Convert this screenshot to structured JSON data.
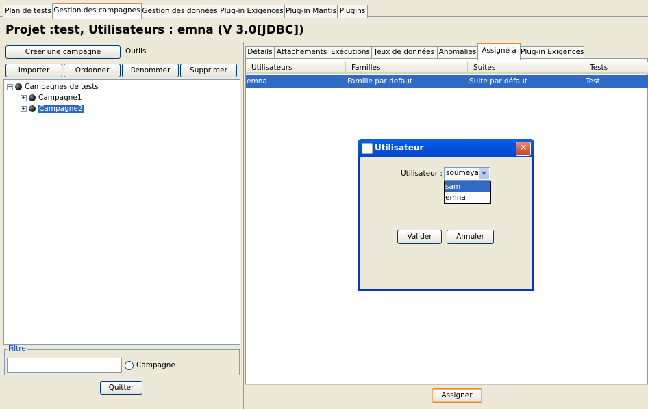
{
  "top_tabs": [
    {
      "label": "Plan de tests"
    },
    {
      "label": "Gestion des campagnes",
      "active": true
    },
    {
      "label": "Gestion des données"
    },
    {
      "label": "Plug-in Exigences"
    },
    {
      "label": "Plug-in Mantis"
    },
    {
      "label": "Plugins"
    }
  ],
  "header": {
    "title": "Projet :test, Utilisateurs : emna (V 3.0[JDBC])"
  },
  "left": {
    "create_campaign_label": "Créer une campagne",
    "tools_label": "Outils",
    "buttons": {
      "import": "Importer",
      "order": "Ordonner",
      "rename": "Renommer",
      "delete": "Supprimer"
    },
    "tree": {
      "root": "Campagnes de tests",
      "items": [
        {
          "label": "Campagne1"
        },
        {
          "label": "Campagne2",
          "selected": true
        }
      ]
    },
    "filter": {
      "legend": "Filtre",
      "value": "",
      "radio_label": "Campagne"
    },
    "quit_label": "Quitter"
  },
  "right": {
    "tabs": [
      {
        "label": "Détails"
      },
      {
        "label": "Attachements"
      },
      {
        "label": "Exécutions"
      },
      {
        "label": "Jeux de données"
      },
      {
        "label": "Anomalies"
      },
      {
        "label": "Assigné à",
        "active": true
      },
      {
        "label": "Plug-in Exigences"
      }
    ],
    "table": {
      "columns": [
        "Utilisateurs",
        "Familles",
        "Suites",
        "Tests"
      ],
      "rows": [
        [
          "emna",
          "Famille par defaut",
          "Suite par défaut",
          "Test"
        ]
      ]
    },
    "assign_label": "Assigner"
  },
  "dialog": {
    "title": "Utilisateur",
    "field_label": "Utilisateur :",
    "selected_value": "soumeya",
    "options": [
      {
        "label": "sam",
        "highlighted": true
      },
      {
        "label": "emna"
      }
    ],
    "ok_label": "Valider",
    "cancel_label": "Annuler"
  },
  "colors": {
    "accent_tab": "#e68b2c",
    "selection": "#316ac5",
    "title_bar": "#0355dd"
  }
}
